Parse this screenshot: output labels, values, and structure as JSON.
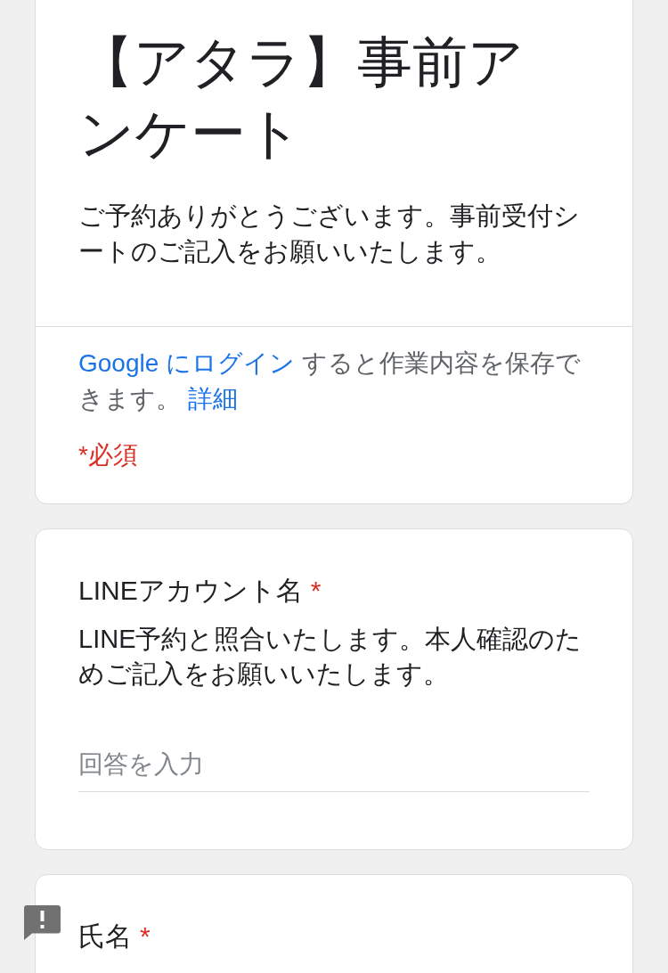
{
  "header_card": {
    "title": "【アタラ】事前アンケート",
    "description": "ご予約ありがとうございます。事前受付シートのご記入をお願いいたします。",
    "signin_note": [
      {
        "kind": "link",
        "text": "Google にログイン"
      },
      {
        "kind": "text",
        "text": "すると作業内容を保存できます。"
      },
      {
        "kind": "link",
        "text": "詳細"
      }
    ],
    "required_note": "*必須"
  },
  "questions": [
    {
      "title": "LINEアカウント名",
      "required_mark": "*",
      "description": "LINE予約と照合いたします。本人確認のためご記入をお願いいたします。",
      "answer": {
        "placeholder": "回答を入力"
      }
    },
    {
      "title": "氏名",
      "required_mark": "*"
    }
  ]
}
